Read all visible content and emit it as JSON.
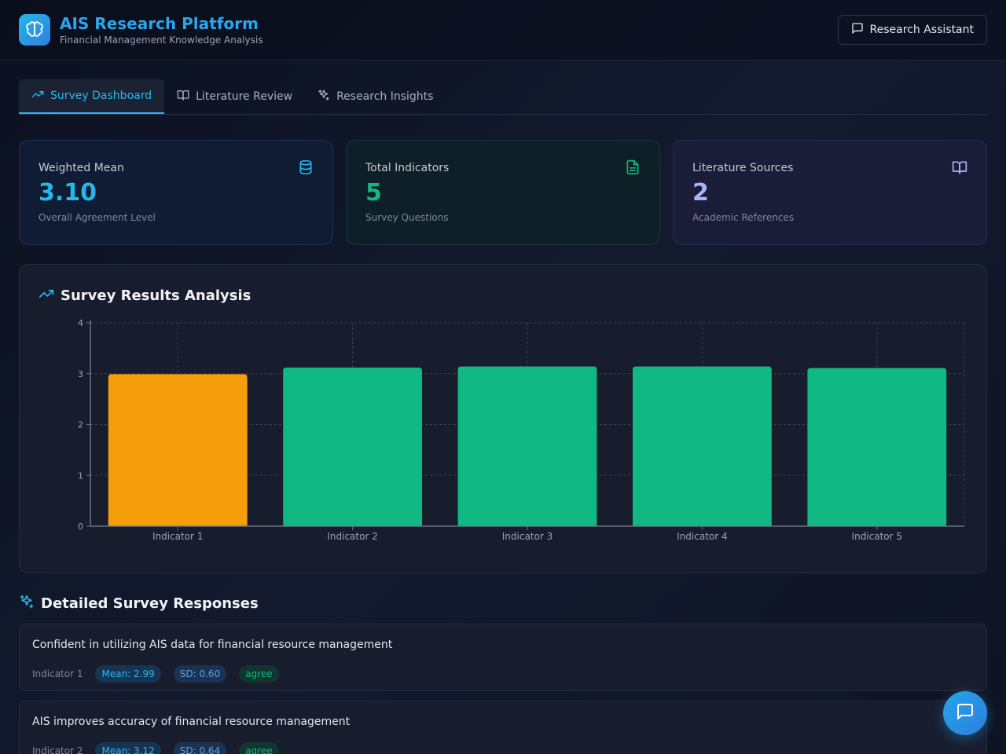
{
  "header": {
    "title": "AIS Research Platform",
    "subtitle": "Financial Management Knowledge Analysis",
    "assistant_label": "Research Assistant"
  },
  "tabs": [
    {
      "label": "Survey Dashboard",
      "icon": "trending-up-icon",
      "active": true
    },
    {
      "label": "Literature Review",
      "icon": "book-open-icon",
      "active": false
    },
    {
      "label": "Research Insights",
      "icon": "sparkles-icon",
      "active": false
    }
  ],
  "cards": [
    {
      "label": "Weighted Mean",
      "value": "3.10",
      "sub": "Overall Agreement Level",
      "icon": "database-icon",
      "color": "#22b8e8"
    },
    {
      "label": "Total Indicators",
      "value": "5",
      "sub": "Survey Questions",
      "icon": "file-text-icon",
      "color": "#10b981"
    },
    {
      "label": "Literature Sources",
      "value": "2",
      "sub": "Academic References",
      "icon": "book-open-icon",
      "color": "#a5b4fc"
    }
  ],
  "chart_panel": {
    "title": "Survey Results Analysis"
  },
  "chart_data": {
    "type": "bar",
    "categories": [
      "Indicator 1",
      "Indicator 2",
      "Indicator 3",
      "Indicator 4",
      "Indicator 5"
    ],
    "values": [
      2.99,
      3.12,
      3.14,
      3.14,
      3.11
    ],
    "colors": [
      "#f59e0b",
      "#10b981",
      "#10b981",
      "#10b981",
      "#10b981"
    ],
    "ylim": [
      0,
      4
    ],
    "yticks": [
      "0",
      "1",
      "2",
      "3",
      "4"
    ],
    "grid": true,
    "title": "",
    "xlabel": "",
    "ylabel": ""
  },
  "responses_section": {
    "title": "Detailed Survey Responses"
  },
  "responses": [
    {
      "question": "Confident in utilizing AIS data for financial resource management",
      "indicator": "Indicator 1",
      "mean": "Mean: 2.99",
      "sd": "SD: 0.60",
      "tag": "agree"
    },
    {
      "question": "AIS improves accuracy of financial resource management",
      "indicator": "Indicator 2",
      "mean": "Mean: 3.12",
      "sd": "SD: 0.64",
      "tag": "agree"
    }
  ]
}
